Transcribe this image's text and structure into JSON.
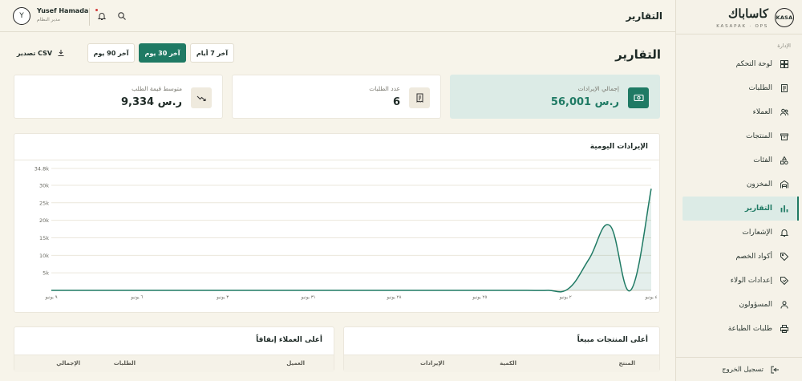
{
  "brand": {
    "logo_text": "KASA",
    "name_ar": "كاساباك",
    "tagline": "KASAPAK · OPS"
  },
  "sidebar": {
    "section_label": "الإدارة",
    "items": [
      {
        "label": "لوحة التحكم",
        "icon": "dashboard-icon",
        "active": false
      },
      {
        "label": "الطلبات",
        "icon": "orders-icon",
        "active": false
      },
      {
        "label": "العملاء",
        "icon": "customers-icon",
        "active": false
      },
      {
        "label": "المنتجات",
        "icon": "products-icon",
        "active": false
      },
      {
        "label": "الفئات",
        "icon": "categories-icon",
        "active": false
      },
      {
        "label": "المخزون",
        "icon": "inventory-icon",
        "active": false
      },
      {
        "label": "التقارير",
        "icon": "reports-icon",
        "active": true
      },
      {
        "label": "الإشعارات",
        "icon": "bell-icon",
        "active": false
      },
      {
        "label": "أكواد الخصم",
        "icon": "tag-icon",
        "active": false
      },
      {
        "label": "إعدادات الولاء",
        "icon": "loyalty-icon",
        "active": false
      },
      {
        "label": "المسؤولون",
        "icon": "admins-icon",
        "active": false
      },
      {
        "label": "طلبات الطباعة",
        "icon": "printer-icon",
        "active": false
      }
    ],
    "logout_label": "تسجيل الخروج"
  },
  "header": {
    "title": "التقارير",
    "user": {
      "initial": "Y",
      "name": "Yusef Hamada",
      "role": "مدير النظام"
    },
    "notifications_dot": true
  },
  "page": {
    "title": "التقارير",
    "ranges": [
      "آخر 7 أيام",
      "آخر 30 يوم",
      "آخر 90 يوم"
    ],
    "selected_range": "آخر 30 يوم",
    "export_label": "تصدير CSV"
  },
  "stats": [
    {
      "label": "إجمالي الإيرادات",
      "value": "56,001 ر.س",
      "icon": "money-icon"
    },
    {
      "label": "عدد الطلبات",
      "value": "6",
      "icon": "receipt-icon"
    },
    {
      "label": "متوسط قيمة الطلب",
      "value": "9,334 ر.س",
      "icon": "trend-icon"
    }
  ],
  "chart_data": {
    "type": "area",
    "title": "الإيرادات اليومية",
    "color": "#1f7a64",
    "xlabels": [
      "٩ يونيو",
      "٦ يونيو",
      "٣ يونيو",
      "٣١ يونيو",
      "٢٨ يونيو",
      "٢٥ يونيو",
      "٢ يونيو",
      "٤ يونيو"
    ],
    "yticks": [
      "34.8k",
      "30k",
      "25k",
      "20k",
      "15k",
      "10k",
      "5k"
    ],
    "ylim": [
      0,
      34800
    ],
    "days": 30,
    "values": [
      0,
      0,
      0,
      0,
      0,
      0,
      0,
      0,
      0,
      0,
      0,
      0,
      0,
      0,
      0,
      0,
      0,
      0,
      0,
      0,
      0,
      0,
      0,
      0,
      0,
      500,
      9000,
      18500,
      0,
      29000
    ]
  },
  "tables": {
    "products": {
      "title": "أعلى المنتجات مبيعاً",
      "columns": [
        "المنتج",
        "الكمية",
        "الإيرادات"
      ]
    },
    "customers": {
      "title": "أعلى العملاء إنفاقاً",
      "columns": [
        "العميل",
        "الطلبات",
        "الإجمالي"
      ]
    }
  }
}
